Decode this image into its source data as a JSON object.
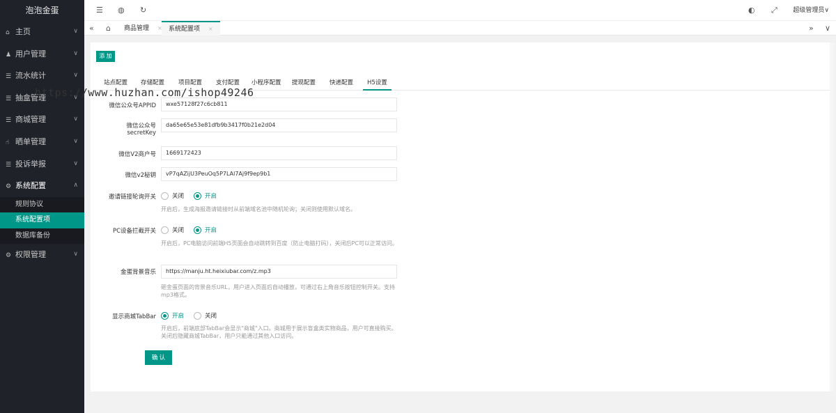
{
  "sidebar": {
    "logo": "泡泡金蛋",
    "items": [
      {
        "label": "主页",
        "icon": "home-icon",
        "glyph": "⌂"
      },
      {
        "label": "用户管理",
        "icon": "users-icon",
        "glyph": "👤"
      },
      {
        "label": "流水统计",
        "icon": "list-icon",
        "glyph": "☰"
      },
      {
        "label": "抽盒管理",
        "icon": "list-icon",
        "glyph": "☰"
      },
      {
        "label": "商城管理",
        "icon": "list-icon",
        "glyph": "☰"
      },
      {
        "label": "晒单管理",
        "icon": "thumb-icon",
        "glyph": "☝"
      },
      {
        "label": "投诉举报",
        "icon": "list-icon",
        "glyph": "☰"
      },
      {
        "label": "系统配置",
        "icon": "settings-icon",
        "glyph": "⚙"
      },
      {
        "label": "权限管理",
        "icon": "settings-icon",
        "glyph": "⚙"
      }
    ],
    "subitems": [
      "规则协议",
      "系统配置项",
      "数据库备份"
    ]
  },
  "header": {
    "user": "超级管理员∨"
  },
  "tabs": {
    "items": [
      {
        "label": "商品管理"
      },
      {
        "label": "系统配置项"
      }
    ]
  },
  "card": {
    "add_label": "添 加",
    "form_tabs": [
      "站点配置",
      "存储配置",
      "项目配置",
      "支付配置",
      "小程序配置",
      "提现配置",
      "快递配置",
      "H5设置"
    ],
    "fields": {
      "appid_label": "微信公众号APPID",
      "appid_value": "wxe57128f27c6cb811",
      "secret_label_1": "微信公众号",
      "secret_label_2": "secretKey",
      "secret_value": "da65e65e53e81dfb9b3417f0b21e2d04",
      "mchid_label": "微信V2商户号",
      "mchid_value": "1669172423",
      "v2key_label": "微信v2秘钥",
      "v2key_value": "vP7qAZijU3PeuOq5P7LAl7Aj9f9ep9b1",
      "invite_label": "邀请链接轮询开关",
      "invite_off": "关闭",
      "invite_on": "开启",
      "invite_help": "开启后，生成海报邀请链接时从前端域名池中随机轮询；关闭则使用默认域名。",
      "pc_label": "PC设备拦截开关",
      "pc_off": "关闭",
      "pc_on": "开启",
      "pc_help": "开启后，PC电脑访问前端H5页面会自动跳转到百度（防止电脑打码），关闭后PC可以正常访问。",
      "music_label": "金蛋背景音乐",
      "music_value": "https://manju.ht.heixiubar.com/z.mp3",
      "music_help": "砸金蛋页面的背景音乐URL，用户进入页面后自动播放，可通过右上角音乐按钮控制开关。支持mp3格式。",
      "tabbar_label": "显示商城TabBar",
      "tabbar_on": "开启",
      "tabbar_off": "关闭",
      "tabbar_help": "开启后，前端底部TabBar会显示\"商城\"入口。商城用于展示盲盒类实物商品，用户可直接购买。关闭后隐藏商城TabBar，用户只能通过其他入口访问。"
    },
    "submit_label": "确 认"
  },
  "watermark": "https://www.huzhan.com/ishop49246",
  "colors": {
    "accent": "#009688",
    "sidebar": "#20222a"
  }
}
